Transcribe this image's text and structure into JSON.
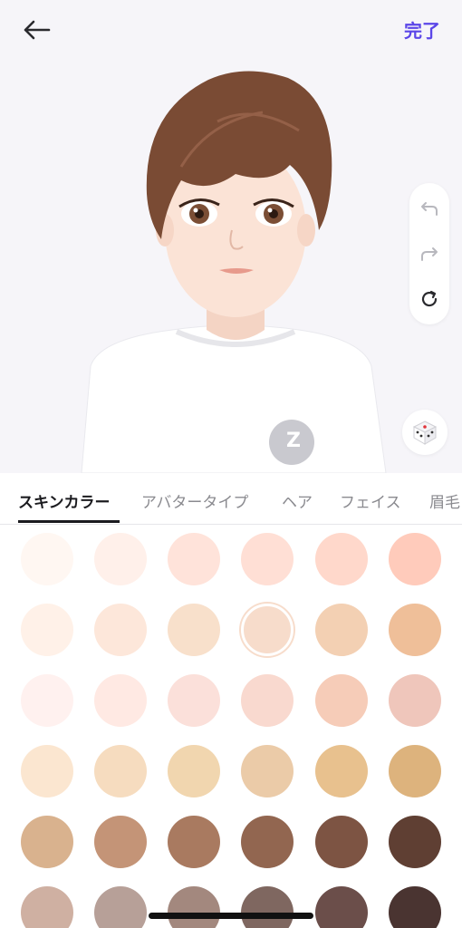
{
  "header": {
    "back_icon": "arrow-left-icon",
    "done_label": "完了",
    "done_color": "#5b46e8"
  },
  "tools": {
    "undo_icon": "undo-icon",
    "redo_icon": "redo-icon",
    "reset_icon": "refresh-icon",
    "random_icon": "dice-icon"
  },
  "avatar": {
    "shirt_logo": "Z"
  },
  "tabs": [
    {
      "label": "スキンカラー",
      "active": true
    },
    {
      "label": "アバタータイプ",
      "active": false
    },
    {
      "label": "ヘア",
      "active": false
    },
    {
      "label": "フェイス",
      "active": false
    },
    {
      "label": "眉毛",
      "active": false
    }
  ],
  "skin_colors": [
    [
      "#fff7f2",
      "#fff0ea",
      "#ffe3da",
      "#ffdfd5",
      "#ffd8cb",
      "#ffcbbb"
    ],
    [
      "#fff1e8",
      "#fde7da",
      "#f8e0cb",
      "#f7dccb",
      "#f3d0b3",
      "#efbf99"
    ],
    [
      "#fff1ef",
      "#ffe9e3",
      "#fbe0da",
      "#f9d9cf",
      "#f6ccb8",
      "#efc6bb"
    ],
    [
      "#fbe6d0",
      "#f6dcbf",
      "#f1d6af",
      "#ebcba8",
      "#e8c18e",
      "#ddb37d"
    ],
    [
      "#d9b28e",
      "#c49477",
      "#a97a60",
      "#926650",
      "#7d5443",
      "#5f3f33"
    ],
    [
      "#cfb0a2",
      "#b7a098",
      "#a3887e",
      "#7f6760",
      "#6b4e4a",
      "#4a3431"
    ]
  ],
  "selected_color": {
    "row": 1,
    "col": 3
  }
}
